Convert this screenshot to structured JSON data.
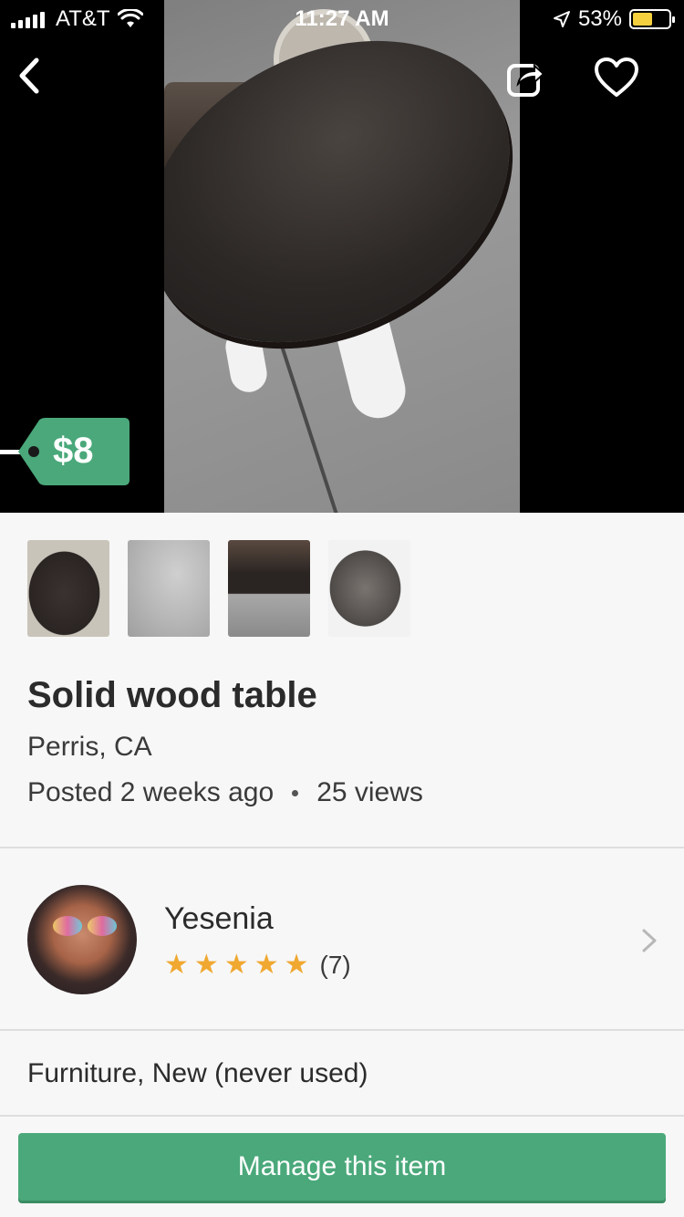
{
  "status_bar": {
    "carrier": "AT&T",
    "time": "11:27 AM",
    "battery_percent": "53%",
    "icons": [
      "signal-icon",
      "wifi-icon",
      "location-arrow-icon",
      "battery-icon"
    ]
  },
  "header": {
    "back_icon": "chevron-left-icon",
    "share_icon": "share-icon",
    "favorite_icon": "heart-outline-icon"
  },
  "listing": {
    "price": "$8",
    "title": "Solid wood table",
    "location": "Perris, CA",
    "posted": "Posted 2 weeks ago",
    "views": "25 views",
    "category_condition": "Furniture, New (never used)",
    "thumbnail_count": 4
  },
  "seller": {
    "name": "Yesenia",
    "rating": 5,
    "max_rating": 5,
    "review_count": "(7)"
  },
  "actions": {
    "manage_label": "Manage this item"
  },
  "colors": {
    "accent_green": "#4aa87a",
    "star_gold": "#f0a830",
    "battery_yellow": "#f4d03f"
  }
}
